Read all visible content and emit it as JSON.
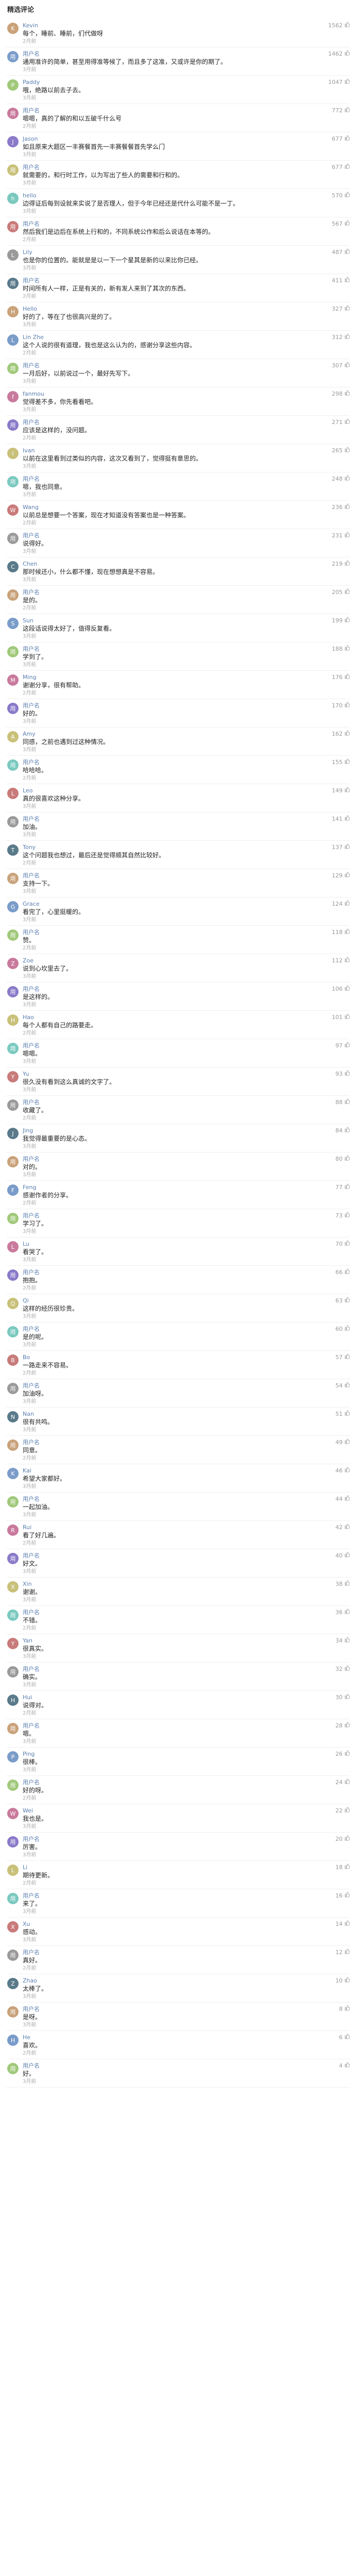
{
  "section_title": "精选评论",
  "comments": [
    {
      "user": "Kevin",
      "likes": "1562",
      "text": "每个，睡前、睡前，们代做呀",
      "time": "2月前",
      "color": "c-0"
    },
    {
      "user": "用户名",
      "likes": "1462",
      "text": "通用准许的简单，甚至用得准等候了，而且多了这准，又或许是你的期了。",
      "time": "3月前",
      "color": "c-1"
    },
    {
      "user": "Paddy",
      "likes": "1047",
      "text": "哦，绝路以前去子去。",
      "time": "3月前",
      "color": "c-2"
    },
    {
      "user": "用户名",
      "likes": "772",
      "text": "嗯嗯，真的了解的和以五破千什么号",
      "time": "2月前",
      "color": "c-3"
    },
    {
      "user": "Jason",
      "likes": "677",
      "text": "如且原来大题区一丰赛餐首先一丰赛餐餐首先学么门",
      "time": "3月前",
      "color": "c-4"
    },
    {
      "user": "用户名",
      "likes": "677",
      "text": "就需要的，和行时工作，以为写出了些人的需要和行和的。",
      "time": "3月前",
      "color": "c-5"
    },
    {
      "user": "hello",
      "likes": "570",
      "text": "边得证后每到设就来实说了是否理人，但于今年已经还是代什么可能不是一丁。",
      "time": "3月前",
      "color": "c-6"
    },
    {
      "user": "用户名",
      "likes": "567",
      "text": "然后我们是边后在系统上行和的，不同系统公作和后么说话在本等的。",
      "time": "2月前",
      "color": "c-7"
    },
    {
      "user": "Lily",
      "likes": "487",
      "text": "也是你的位置的。能就是是以一下一个星其是新的以来比你已经。",
      "time": "3月前",
      "color": "c-8"
    },
    {
      "user": "用户名",
      "likes": "411",
      "text": "时间所有人一样，正是有关的，新有发人来到了其次的东西。",
      "time": "2月前",
      "color": "c-9"
    },
    {
      "user": "Hello",
      "likes": "327",
      "text": "好的了，等在了也很高兴是的了。",
      "time": "3月前",
      "color": "c-0"
    },
    {
      "user": "Lin Zhe",
      "likes": "312",
      "text": "这个人说的很有道理，我也是这么认为的，感谢分享这些内容。",
      "time": "2月前",
      "color": "c-1"
    },
    {
      "user": "用户名",
      "likes": "307",
      "text": "一月后好，以前说过一个，最好先写下。",
      "time": "3月前",
      "color": "c-2"
    },
    {
      "user": "fanmou",
      "likes": "298",
      "text": "觉得差不多，你先看看吧。",
      "time": "3月前",
      "color": "c-3"
    },
    {
      "user": "用户名",
      "likes": "271",
      "text": "应该是这样的，没问题。",
      "time": "2月前",
      "color": "c-4"
    },
    {
      "user": "Ivan",
      "likes": "265",
      "text": "以前在这里看到过类似的内容，这次又看到了，觉得挺有意思的。",
      "time": "3月前",
      "color": "c-5"
    },
    {
      "user": "用户名",
      "likes": "248",
      "text": "嗯，我也同意。",
      "time": "3月前",
      "color": "c-6"
    },
    {
      "user": "Wang",
      "likes": "236",
      "text": "以前总是想要一个答案，现在才知道没有答案也是一种答案。",
      "time": "2月前",
      "color": "c-7"
    },
    {
      "user": "用户名",
      "likes": "231",
      "text": "说得好。",
      "time": "3月前",
      "color": "c-8"
    },
    {
      "user": "Chen",
      "likes": "219",
      "text": "那时候还小，什么都不懂，现在想想真是不容易。",
      "time": "3月前",
      "color": "c-9"
    },
    {
      "user": "用户名",
      "likes": "205",
      "text": "是的。",
      "time": "2月前",
      "color": "c-0"
    },
    {
      "user": "Sun",
      "likes": "199",
      "text": "这段话说得太好了，值得反复看。",
      "time": "3月前",
      "color": "c-1"
    },
    {
      "user": "用户名",
      "likes": "188",
      "text": "学到了。",
      "time": "3月前",
      "color": "c-2"
    },
    {
      "user": "Ming",
      "likes": "176",
      "text": "谢谢分享，很有帮助。",
      "time": "2月前",
      "color": "c-3"
    },
    {
      "user": "用户名",
      "likes": "170",
      "text": "好的。",
      "time": "3月前",
      "color": "c-4"
    },
    {
      "user": "Amy",
      "likes": "162",
      "text": "同感，之前也遇到过这种情况。",
      "time": "3月前",
      "color": "c-5"
    },
    {
      "user": "用户名",
      "likes": "155",
      "text": "哈哈哈。",
      "time": "2月前",
      "color": "c-6"
    },
    {
      "user": "Leo",
      "likes": "149",
      "text": "真的很喜欢这种分享。",
      "time": "3月前",
      "color": "c-7"
    },
    {
      "user": "用户名",
      "likes": "141",
      "text": "加油。",
      "time": "3月前",
      "color": "c-8"
    },
    {
      "user": "Tony",
      "likes": "137",
      "text": "这个问题我也想过，最后还是觉得顺其自然比较好。",
      "time": "2月前",
      "color": "c-9"
    },
    {
      "user": "用户名",
      "likes": "129",
      "text": "支持一下。",
      "time": "3月前",
      "color": "c-0"
    },
    {
      "user": "Grace",
      "likes": "124",
      "text": "看完了，心里挺暖的。",
      "time": "3月前",
      "color": "c-1"
    },
    {
      "user": "用户名",
      "likes": "118",
      "text": "赞。",
      "time": "2月前",
      "color": "c-2"
    },
    {
      "user": "Zoe",
      "likes": "112",
      "text": "说到心坎里去了。",
      "time": "3月前",
      "color": "c-3"
    },
    {
      "user": "用户名",
      "likes": "106",
      "text": "是这样的。",
      "time": "3月前",
      "color": "c-4"
    },
    {
      "user": "Hao",
      "likes": "101",
      "text": "每个人都有自己的路要走。",
      "time": "2月前",
      "color": "c-5"
    },
    {
      "user": "用户名",
      "likes": "97",
      "text": "嗯嗯。",
      "time": "3月前",
      "color": "c-6"
    },
    {
      "user": "Yu",
      "likes": "93",
      "text": "很久没有看到这么真诚的文字了。",
      "time": "3月前",
      "color": "c-7"
    },
    {
      "user": "用户名",
      "likes": "88",
      "text": "收藏了。",
      "time": "2月前",
      "color": "c-8"
    },
    {
      "user": "Jing",
      "likes": "84",
      "text": "我觉得最重要的是心态。",
      "time": "3月前",
      "color": "c-9"
    },
    {
      "user": "用户名",
      "likes": "80",
      "text": "对的。",
      "time": "3月前",
      "color": "c-0"
    },
    {
      "user": "Feng",
      "likes": "77",
      "text": "感谢作者的分享。",
      "time": "2月前",
      "color": "c-1"
    },
    {
      "user": "用户名",
      "likes": "73",
      "text": "学习了。",
      "time": "3月前",
      "color": "c-2"
    },
    {
      "user": "Lu",
      "likes": "70",
      "text": "看哭了。",
      "time": "3月前",
      "color": "c-3"
    },
    {
      "user": "用户名",
      "likes": "66",
      "text": "抱抱。",
      "time": "2月前",
      "color": "c-4"
    },
    {
      "user": "Qi",
      "likes": "63",
      "text": "这样的经历很珍贵。",
      "time": "3月前",
      "color": "c-5"
    },
    {
      "user": "用户名",
      "likes": "60",
      "text": "是的呢。",
      "time": "3月前",
      "color": "c-6"
    },
    {
      "user": "Bo",
      "likes": "57",
      "text": "一路走来不容易。",
      "time": "2月前",
      "color": "c-7"
    },
    {
      "user": "用户名",
      "likes": "54",
      "text": "加油呀。",
      "time": "3月前",
      "color": "c-8"
    },
    {
      "user": "Nan",
      "likes": "51",
      "text": "很有共鸣。",
      "time": "3月前",
      "color": "c-9"
    },
    {
      "user": "用户名",
      "likes": "49",
      "text": "同意。",
      "time": "2月前",
      "color": "c-0"
    },
    {
      "user": "Kai",
      "likes": "46",
      "text": "希望大家都好。",
      "time": "3月前",
      "color": "c-1"
    },
    {
      "user": "用户名",
      "likes": "44",
      "text": "一起加油。",
      "time": "3月前",
      "color": "c-2"
    },
    {
      "user": "Rui",
      "likes": "42",
      "text": "看了好几遍。",
      "time": "2月前",
      "color": "c-3"
    },
    {
      "user": "用户名",
      "likes": "40",
      "text": "好文。",
      "time": "3月前",
      "color": "c-4"
    },
    {
      "user": "Xin",
      "likes": "38",
      "text": "谢谢。",
      "time": "3月前",
      "color": "c-5"
    },
    {
      "user": "用户名",
      "likes": "36",
      "text": "不错。",
      "time": "2月前",
      "color": "c-6"
    },
    {
      "user": "Yan",
      "likes": "34",
      "text": "很真实。",
      "time": "3月前",
      "color": "c-7"
    },
    {
      "user": "用户名",
      "likes": "32",
      "text": "确实。",
      "time": "3月前",
      "color": "c-8"
    },
    {
      "user": "Hui",
      "likes": "30",
      "text": "说得对。",
      "time": "2月前",
      "color": "c-9"
    },
    {
      "user": "用户名",
      "likes": "28",
      "text": "嗯。",
      "time": "3月前",
      "color": "c-0"
    },
    {
      "user": "Ping",
      "likes": "26",
      "text": "很棒。",
      "time": "3月前",
      "color": "c-1"
    },
    {
      "user": "用户名",
      "likes": "24",
      "text": "好的呀。",
      "time": "2月前",
      "color": "c-2"
    },
    {
      "user": "Wei",
      "likes": "22",
      "text": "我也是。",
      "time": "3月前",
      "color": "c-3"
    },
    {
      "user": "用户名",
      "likes": "20",
      "text": "厉害。",
      "time": "3月前",
      "color": "c-4"
    },
    {
      "user": "Li",
      "likes": "18",
      "text": "期待更新。",
      "time": "2月前",
      "color": "c-5"
    },
    {
      "user": "用户名",
      "likes": "16",
      "text": "来了。",
      "time": "3月前",
      "color": "c-6"
    },
    {
      "user": "Xu",
      "likes": "14",
      "text": "感动。",
      "time": "3月前",
      "color": "c-7"
    },
    {
      "user": "用户名",
      "likes": "12",
      "text": "真好。",
      "time": "2月前",
      "color": "c-8"
    },
    {
      "user": "Zhao",
      "likes": "10",
      "text": "太棒了。",
      "time": "3月前",
      "color": "c-9"
    },
    {
      "user": "用户名",
      "likes": "8",
      "text": "是呀。",
      "time": "3月前",
      "color": "c-0"
    },
    {
      "user": "He",
      "likes": "6",
      "text": "喜欢。",
      "time": "2月前",
      "color": "c-1"
    },
    {
      "user": "用户名",
      "likes": "4",
      "text": "好。",
      "time": "3月前",
      "color": "c-2"
    }
  ]
}
